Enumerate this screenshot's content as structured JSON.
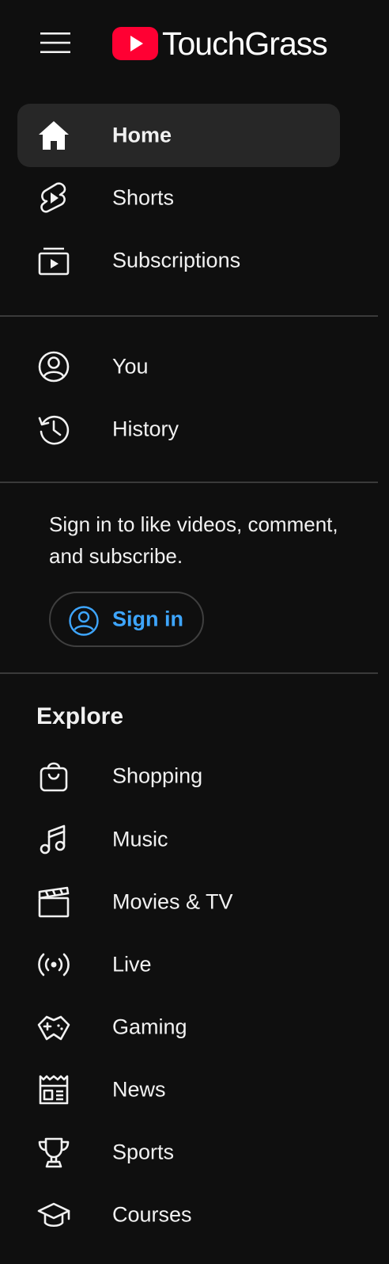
{
  "app": {
    "logo_text": "TouchGrass"
  },
  "nav_main": [
    {
      "label": "Home",
      "icon": "home-icon",
      "active": true
    },
    {
      "label": "Shorts",
      "icon": "shorts-icon"
    },
    {
      "label": "Subscriptions",
      "icon": "subscriptions-icon"
    }
  ],
  "nav_you": [
    {
      "label": "You",
      "icon": "account-icon"
    },
    {
      "label": "History",
      "icon": "history-icon"
    }
  ],
  "signin": {
    "prompt": "Sign in to like videos, comment, and subscribe.",
    "button_label": "Sign in",
    "accent": "#3ea6ff"
  },
  "explore": {
    "title": "Explore",
    "items": [
      {
        "label": "Shopping",
        "icon": "shopping-bag-icon"
      },
      {
        "label": "Music",
        "icon": "music-note-icon"
      },
      {
        "label": "Movies & TV",
        "icon": "clapperboard-icon"
      },
      {
        "label": "Live",
        "icon": "live-broadcast-icon"
      },
      {
        "label": "Gaming",
        "icon": "game-controller-icon"
      },
      {
        "label": "News",
        "icon": "newspaper-icon"
      },
      {
        "label": "Sports",
        "icon": "trophy-icon"
      },
      {
        "label": "Courses",
        "icon": "graduation-cap-icon"
      }
    ]
  },
  "colors": {
    "background": "#0f0f0f",
    "active_item": "#272727",
    "brand_red": "#ff0033",
    "link_blue": "#3ea6ff"
  }
}
